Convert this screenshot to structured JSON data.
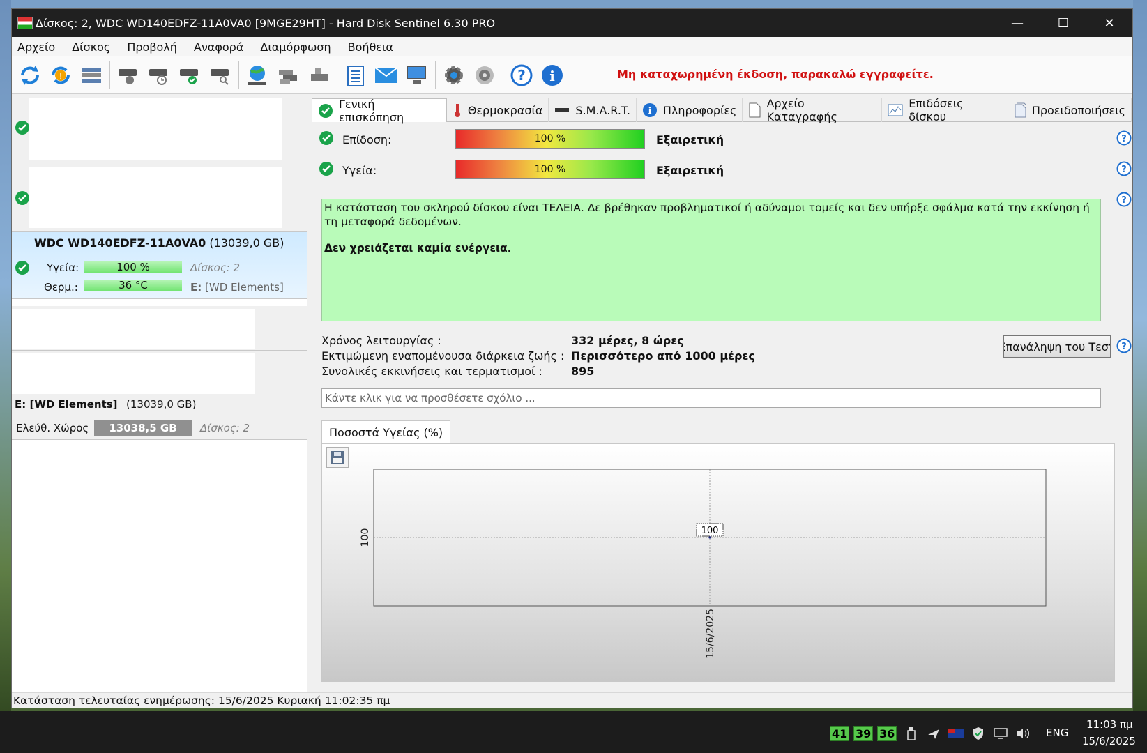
{
  "window": {
    "title": "Δίσκος: 2, WDC WD140EDFZ-11A0VA0 [9MGE29HT]  -  Hard Disk Sentinel 6.30 PRO",
    "minimize": "—",
    "maximize": "☐",
    "close": "✕"
  },
  "menu": [
    "Αρχείο",
    "Δίσκος",
    "Προβολή",
    "Αναφορά",
    "Διαμόρφωση",
    "Βοήθεια"
  ],
  "toolbar": {
    "registration_notice": "Μη καταχωρημένη έκδοση, παρακαλώ εγγραφείτε."
  },
  "left": {
    "selected_disk": {
      "model": "WDC WD140EDFZ-11A0VA0",
      "size": "(13039,0 GB)",
      "health_label": "Υγεία:",
      "health_value": "100 %",
      "disk_index": "Δίσκος: 2",
      "temp_label": "Θερμ.:",
      "temp_value": "36 °C",
      "drive_letter": "E:",
      "volume_name": "[WD Elements]"
    },
    "volume": {
      "name": "E: [WD Elements]",
      "size": "(13039,0 GB)",
      "free_label": "Ελεύθ. Χώρος",
      "free_value": "13038,5 GB",
      "disk_index": "Δίσκος: 2"
    }
  },
  "tabs": [
    "Γενική επισκόπηση",
    "Θερμοκρασία",
    "S.M.A.R.T.",
    "Πληροφορίες",
    "Αρχείο Καταγραφής",
    "Επιδόσεις δίσκου",
    "Προειδοποιήσεις"
  ],
  "overview": {
    "performance_label": "Επίδοση:",
    "performance_value": "100 %",
    "performance_rating": "Εξαιρετική",
    "health_label": "Υγεία:",
    "health_value": "100 %",
    "health_rating": "Εξαιρετική",
    "status_text": "Η κατάσταση του σκληρού δίσκου είναι ΤΕΛΕΙΑ. Δε βρέθηκαν προβληματικοί ή αδύναμοι τομείς και δεν υπήρξε σφάλμα κατά την εκκίνηση ή τη μεταφορά δεδομένων.",
    "status_action": "Δεν χρειάζεται καμία ενέργεια.",
    "power_on_label": "Χρόνος λειτουργίας :",
    "power_on_value": "332 μέρες, 8 ώρες",
    "lifetime_label": "Εκτιμώμενη εναπομένουσα διάρκεια ζωής :",
    "lifetime_value": "Περισσότερο από 1000 μέρες",
    "startstop_label": "Συνολικές εκκινήσεις και τερματισμοί :",
    "startstop_value": "895",
    "retest_button": "Επανάληψη του Τεστ",
    "comment_placeholder": "Κάντε κλικ για να προσθέσετε σχόλιο ..."
  },
  "chart_tab_label": "Ποσοστά Υγείας (%)",
  "chart_data": {
    "type": "line",
    "x": [
      "15/6/2025"
    ],
    "series": [
      {
        "values": [
          100
        ]
      }
    ],
    "data_labels": [
      "100"
    ],
    "y_ticks": [
      "100"
    ],
    "x_ticks": [
      "15/6/2025"
    ],
    "grid": true
  },
  "statusbar": {
    "text": "Κατάσταση τελευταίας ενημέρωσης: 15/6/2025 Κυριακή 11:02:35 πμ"
  },
  "taskbar": {
    "temps": [
      "41",
      "39",
      "36"
    ],
    "language": "ENG",
    "time": "11:03 πμ",
    "date": "15/6/2025"
  },
  "colors": {
    "status_ok_bg": "#b9fbb9",
    "check_green": "#1aa34a",
    "notice_red": "#d01010",
    "titlebar": "#202020"
  }
}
